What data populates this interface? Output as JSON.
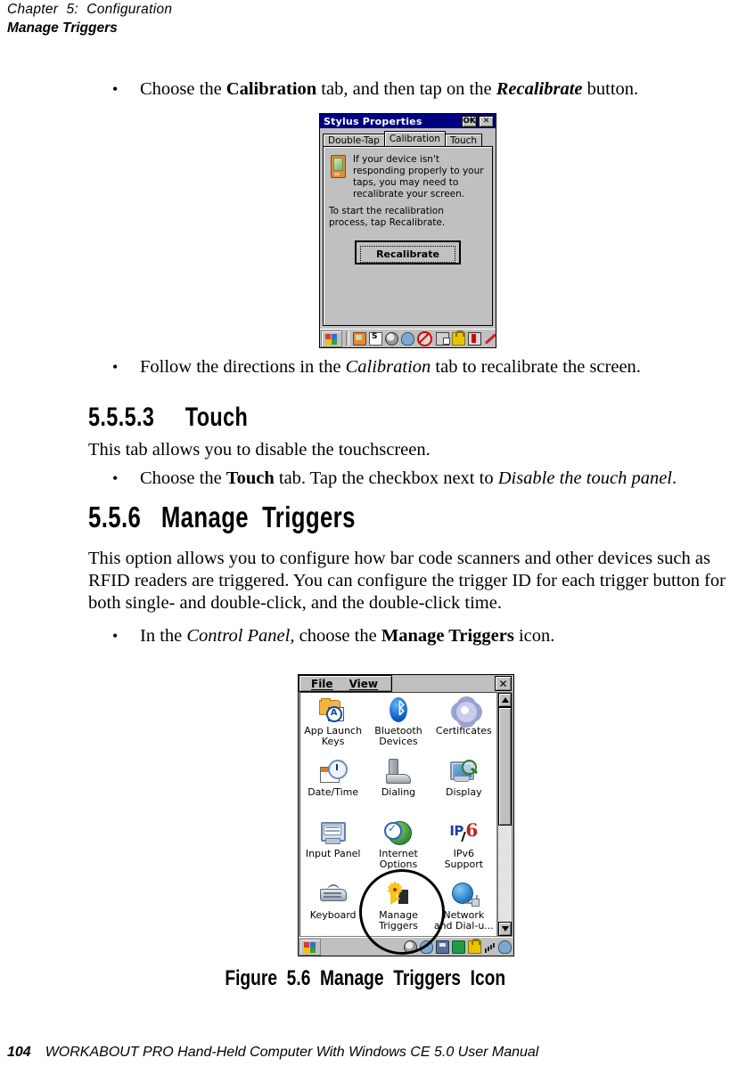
{
  "header": {
    "chapter": "Chapter  5:  Configuration",
    "section": "Manage Triggers"
  },
  "content": {
    "bullet1": {
      "marker": "•",
      "part1": "Choose the ",
      "bold1": "Calibration",
      "part2": " tab, and then tap on the ",
      "bolditalic1": "Recalibrate",
      "part3": " button."
    },
    "bullet2": {
      "marker": "•",
      "part1": "Follow the directions in the ",
      "italic1": "Calibration",
      "part2": " tab to recalibrate the screen."
    },
    "heading_touch": {
      "number": "5.5.5.3",
      "title": "Touch"
    },
    "para_touch": "This tab allows you to disable the touchscreen.",
    "bullet3": {
      "marker": "•",
      "part1": "Choose the ",
      "bold1": "Touch",
      "part2": " tab. Tap the checkbox next to ",
      "italic1": "Disable the touch panel",
      "part3": "."
    },
    "heading_manage": {
      "number": "5.5.6",
      "title": "Manage  Triggers"
    },
    "para_manage": "This option allows you to configure how bar code scanners and other devices such as RFID readers are triggered. You can configure the trigger ID for each trigger button for both single- and double-click, and the double-click time.",
    "bullet4": {
      "marker": "•",
      "part1": "In the ",
      "italic1": "Control Panel",
      "part2": ", choose the ",
      "bold1": "Manage Triggers",
      "part3": " icon."
    },
    "figure_caption": "Figure  5.6  Manage  Triggers  Icon"
  },
  "stylus_dialog": {
    "title": "Stylus Properties",
    "ok_label": "OK",
    "close_label": "✕",
    "tabs": [
      {
        "label": "Double-Tap",
        "selected": false
      },
      {
        "label": "Calibration",
        "selected": true
      },
      {
        "label": "Touch",
        "selected": false
      }
    ],
    "message1": "If your device isn't responding properly to your taps, you may need to recalibrate your screen.",
    "message2": "To start the recalibration process, tap Recalibrate.",
    "button_label": "Recalibrate",
    "taskbar": {
      "start_icon": "windows-start-icon",
      "tray_icons": [
        "pda-device-icon",
        "document-s-icon",
        "globe-icon",
        "plug-icon",
        "scanner-disabled-icon",
        "network-icon",
        "lock-icon",
        "battery-icon",
        "stylus-pen-icon"
      ]
    }
  },
  "control_panel": {
    "menus": [
      {
        "label": "File",
        "accel": "F"
      },
      {
        "label": "View",
        "accel": "V"
      }
    ],
    "close_label": "✕",
    "items": [
      {
        "label": "App Launch\nKeys",
        "icon": "app-launch-keys-icon"
      },
      {
        "label": "Bluetooth\nDevices",
        "icon": "bluetooth-devices-icon"
      },
      {
        "label": "Certificates",
        "icon": "certificates-icon"
      },
      {
        "label": "Date/Time",
        "icon": "date-time-icon"
      },
      {
        "label": "Dialing",
        "icon": "dialing-icon"
      },
      {
        "label": "Display",
        "icon": "display-icon"
      },
      {
        "label": "Input Panel",
        "icon": "input-panel-icon"
      },
      {
        "label": "Internet\nOptions",
        "icon": "internet-options-icon"
      },
      {
        "label": "IPv6\nSupport",
        "icon": "ipv6-support-icon"
      },
      {
        "label": "Keyboard",
        "icon": "keyboard-icon"
      },
      {
        "label": "Manage\nTriggers",
        "icon": "manage-triggers-icon"
      },
      {
        "label": "Network\nand Dial-u...",
        "icon": "network-dialup-icon"
      }
    ],
    "scrollbar": {
      "up": "▲",
      "down": "▼",
      "thumb_fraction": "55%"
    },
    "taskbar": {
      "start_icon": "windows-start-icon",
      "tray_icons": [
        "globe-icon",
        "plug-icon",
        "disk-icon",
        "phone-icon",
        "lock-icon",
        "signal-bars-icon",
        "power-plug-icon"
      ]
    },
    "annotation": "circle-highlight-manage-triggers"
  },
  "footer": {
    "page_number": "104",
    "text": "WORKABOUT PRO Hand-Held Computer With Windows CE 5.0 User Manual"
  },
  "colors": {
    "titlebar": "#000080",
    "window_face": "#c0c0c0",
    "page_background": "#ffffff",
    "text": "#000000"
  }
}
